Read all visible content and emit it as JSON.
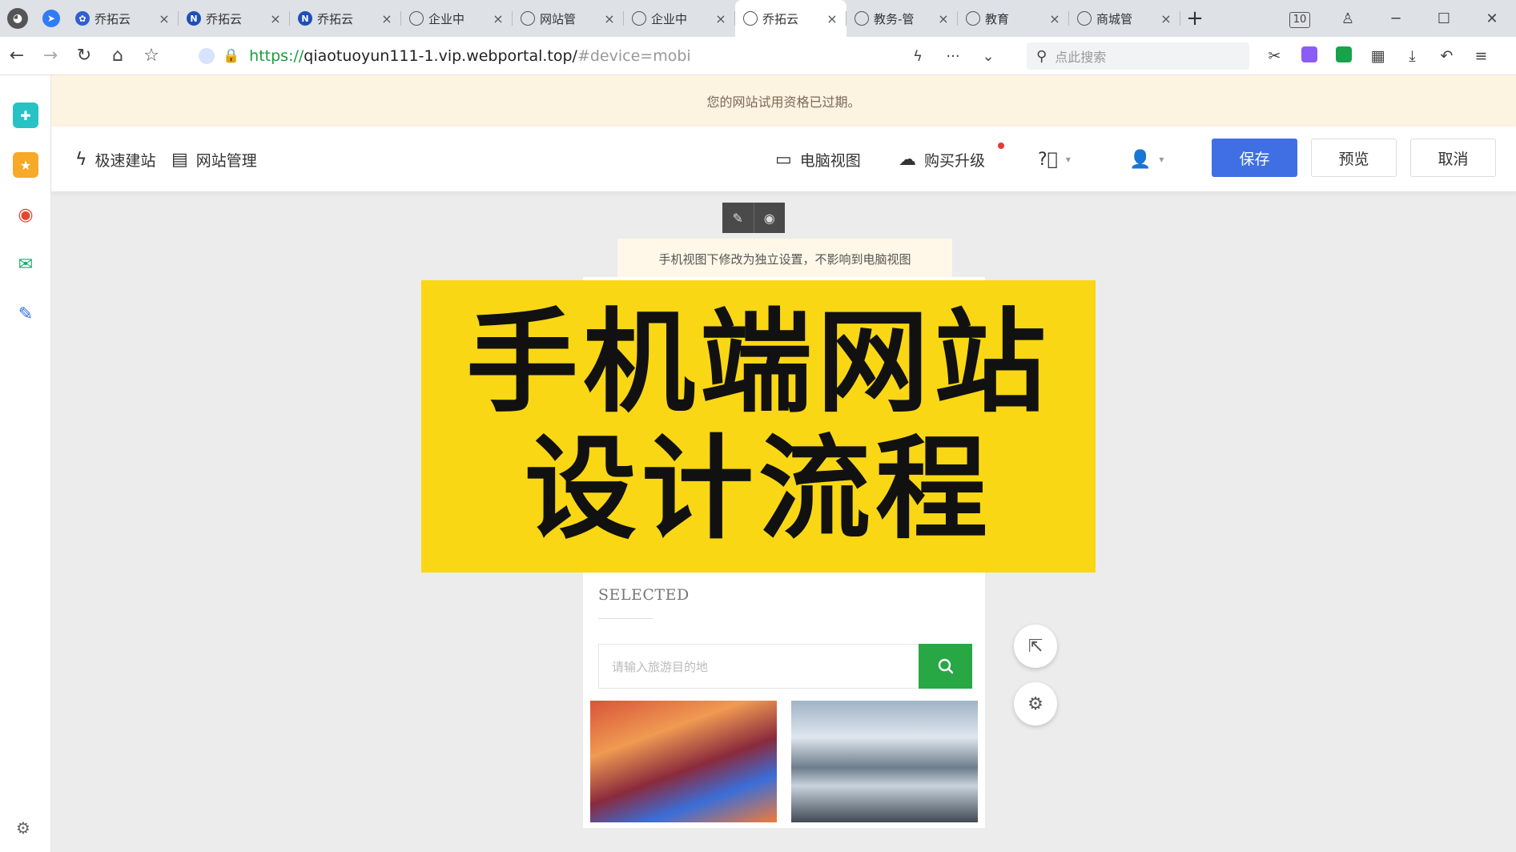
{
  "browser": {
    "tabs": [
      {
        "label": "乔拓云",
        "icon": "paw-icon"
      },
      {
        "label": "乔拓云",
        "icon": "n-logo-icon"
      },
      {
        "label": "乔拓云",
        "icon": "n-logo-icon"
      },
      {
        "label": "企业中",
        "icon": "globe-icon"
      },
      {
        "label": "网站管",
        "icon": "globe-icon"
      },
      {
        "label": "企业中",
        "icon": "globe-icon"
      },
      {
        "label": "乔拓云",
        "icon": "globe-icon",
        "active": true
      },
      {
        "label": "教务-管",
        "icon": "globe-icon"
      },
      {
        "label": "教育",
        "icon": "globe-icon"
      },
      {
        "label": "商城管",
        "icon": "globe-icon"
      }
    ],
    "tab_count_badge": "10",
    "url": {
      "scheme": "https://",
      "host": "qiaotuoyun111-1.vip.webportal.top/",
      "fragment": "#device=mobi"
    },
    "search_placeholder": "点此搜索"
  },
  "notice": "您的网站试用资格已过期。",
  "editor": {
    "quick_build": "极速建站",
    "site_manage": "网站管理",
    "pc_view": "电脑视图",
    "buy_upgrade": "购买升级",
    "save": "保存",
    "preview": "预览",
    "cancel": "取消"
  },
  "canvas": {
    "hint": "手机视图下修改为独立设置，不影响到电脑视图",
    "section_title": "SELECTED",
    "search_placeholder": "请输入旅游目的地"
  },
  "overlay": {
    "line1": "手机端网站",
    "line2": "设计流程"
  },
  "colors": {
    "primary": "#3f6fe3",
    "search_green": "#28a745",
    "overlay_yellow": "#f9d714",
    "notice_bg": "#fdf3e1"
  }
}
